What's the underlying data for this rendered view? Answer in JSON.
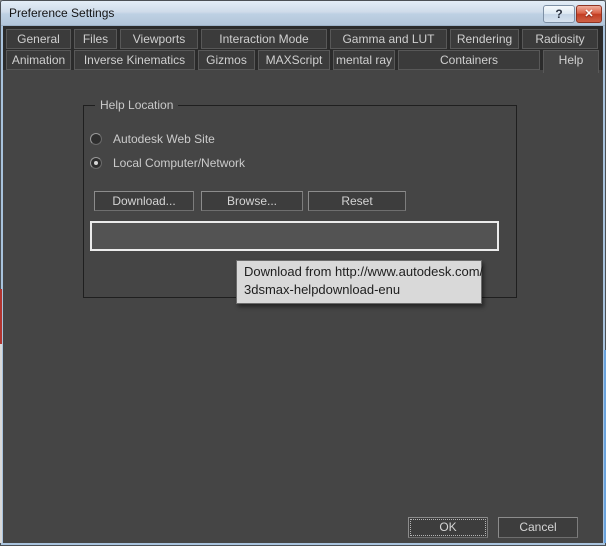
{
  "window": {
    "title": "Preference Settings"
  },
  "titlebar": {
    "help_button_glyph": "?",
    "close_button_glyph": "✕"
  },
  "tabs": {
    "row1": [
      {
        "label": "General",
        "active": false
      },
      {
        "label": "Files",
        "active": false
      },
      {
        "label": "Viewports",
        "active": false
      },
      {
        "label": "Interaction Mode",
        "active": false
      },
      {
        "label": "Gamma and LUT",
        "active": false
      },
      {
        "label": "Rendering",
        "active": false
      },
      {
        "label": "Radiosity",
        "active": false
      }
    ],
    "row2": [
      {
        "label": "Animation",
        "active": false
      },
      {
        "label": "Inverse Kinematics",
        "active": false
      },
      {
        "label": "Gizmos",
        "active": false
      },
      {
        "label": "MAXScript",
        "active": false
      },
      {
        "label": "mental ray",
        "active": false
      },
      {
        "label": "Containers",
        "active": false
      },
      {
        "label": "Help",
        "active": true
      }
    ]
  },
  "help_location": {
    "group_label": "Help Location",
    "radios": [
      {
        "label": "Autodesk Web Site",
        "selected": false
      },
      {
        "label": "Local Computer/Network",
        "selected": true
      }
    ],
    "download_label": "Download...",
    "browse_label": "Browse...",
    "reset_label": "Reset",
    "path_value": ""
  },
  "tooltip": {
    "line1": "Download from http://www.autodesk.com/",
    "line2": "3dsmax-helpdownload-enu"
  },
  "footer": {
    "ok_label": "OK",
    "cancel_label": "Cancel"
  },
  "colors": {
    "body_background": "#454545",
    "tab_background": "#3b3b3b",
    "titlebar_gradient_top": "#e3edf7",
    "frame_blue": "#a9c3dd",
    "close_button_red": "#c23d23",
    "tooltip_background": "#d9d9d9",
    "field_border_white": "#ececec"
  }
}
